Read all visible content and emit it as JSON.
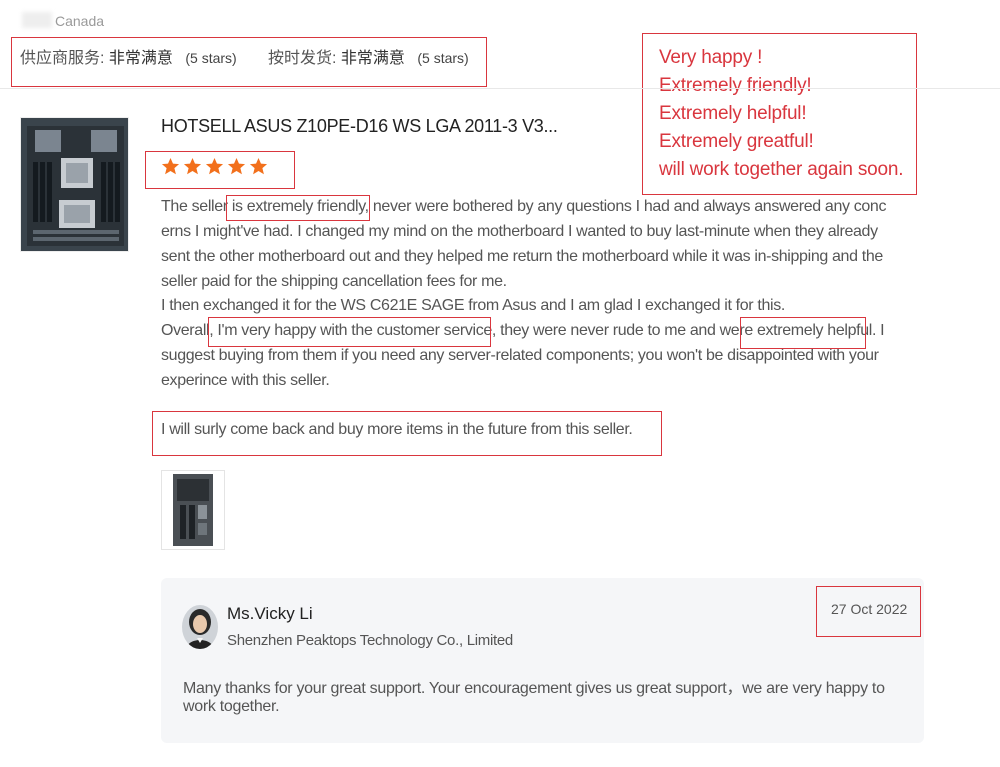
{
  "reviewer": {
    "country": "Canada"
  },
  "ratings": {
    "supplier_service_label": "供应商服务:",
    "supplier_service_value": "非常满意",
    "supplier_service_stars": "(5 stars)",
    "shipping_label": "按时发货:",
    "shipping_value": "非常满意",
    "shipping_stars": "(5 stars)"
  },
  "annotation_note": {
    "lines": [
      "Very happy !",
      "Extremely friendly!",
      "Extremely helpful!",
      "Extremely greatful!",
      "will work together again soon."
    ],
    "color": "#d9363e"
  },
  "product": {
    "title": "HOTSELL ASUS Z10PE-D16 WS LGA 2011-3 V3...",
    "thumbnail_icon": "motherboard-photo"
  },
  "review": {
    "stars": 5,
    "star_color": "#f2701c",
    "lines": [
      "The seller is extremely friendly, never were bothered by any questions I had and always answered any conc",
      "erns I might've had. I changed my mind on the motherboard I wanted to buy last-minute when they already",
      "sent the other motherboard out and they helped me return the motherboard while it was in-shipping and the",
      "seller paid for the shipping cancellation fees for me.",
      "I then exchanged it for the WS C621E SAGE from Asus and I am glad I exchanged it for this.",
      "Overall, I'm very happy with the customer service, they were never rude to me and were extremely helpful. I",
      "suggest buying from them if you need any server-related components; you won't be disappointed with your",
      "experince with this seller."
    ],
    "closing": "I will surly come back and buy more items in the future from this seller."
  },
  "reply": {
    "name": "Ms.Vicky Li",
    "company": "Shenzhen Peaktops Technology Co., Limited",
    "date": "27 Oct 2022",
    "lines": [
      "Many thanks for your great support. Your encouragement gives us great support，we are very happy to",
      "work together."
    ]
  }
}
